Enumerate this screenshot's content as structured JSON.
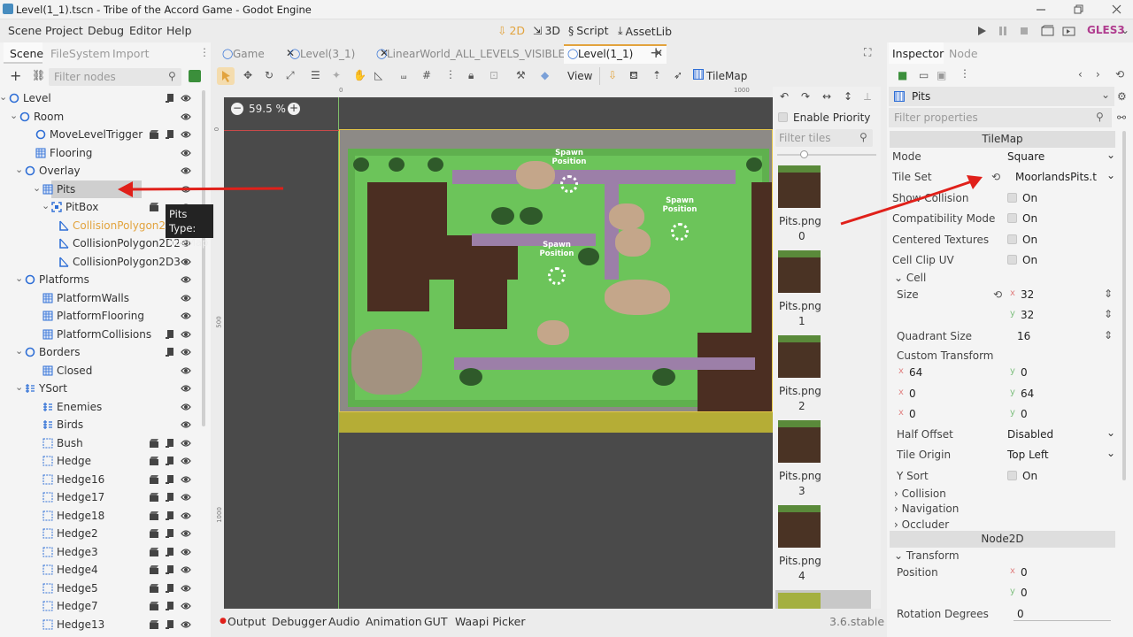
{
  "window": {
    "title": "Level(1_1).tscn - Tribe of the Accord Game - Godot Engine"
  },
  "menu": {
    "items": [
      "Scene",
      "Project",
      "Debug",
      "Editor",
      "Help"
    ]
  },
  "workspaces": {
    "w2d": "2D",
    "w3d": "3D",
    "script": "Script",
    "assetlib": "AssetLib"
  },
  "renderer": "GLES3",
  "scene_dock": {
    "tabs": [
      "Scene",
      "FileSystem",
      "Import"
    ],
    "filter_placeholder": "Filter nodes",
    "tree": [
      {
        "label": "Level"
      },
      {
        "label": "Room"
      },
      {
        "label": "MoveLevelTrigger"
      },
      {
        "label": "Flooring"
      },
      {
        "label": "Overlay"
      },
      {
        "label": "Pits"
      },
      {
        "label": "PitBox"
      },
      {
        "label": "CollisionPolygon2D"
      },
      {
        "label": "CollisionPolygon2D2"
      },
      {
        "label": "CollisionPolygon2D3"
      },
      {
        "label": "Platforms"
      },
      {
        "label": "PlatformWalls"
      },
      {
        "label": "PlatformFlooring"
      },
      {
        "label": "PlatformCollisions"
      },
      {
        "label": "Borders"
      },
      {
        "label": "Closed"
      },
      {
        "label": "YSort"
      },
      {
        "label": "Enemies"
      },
      {
        "label": "Birds"
      },
      {
        "label": "Bush"
      },
      {
        "label": "Hedge"
      },
      {
        "label": "Hedge16"
      },
      {
        "label": "Hedge17"
      },
      {
        "label": "Hedge18"
      },
      {
        "label": "Hedge2"
      },
      {
        "label": "Hedge3"
      },
      {
        "label": "Hedge4"
      },
      {
        "label": "Hedge5"
      },
      {
        "label": "Hedge7"
      },
      {
        "label": "Hedge13"
      }
    ],
    "tooltip": {
      "name": "Pits",
      "type": "Type: TileMap"
    }
  },
  "editor_tabs": [
    "Game",
    "Level(3_1)",
    "LinearWorld_ALL_LEVELS_VISIBLE",
    "Level(1_1)"
  ],
  "toolbar": {
    "view": "View",
    "tilemap": "TileMap"
  },
  "viewport": {
    "zoom": "59.5 %",
    "ruler_ticks": [
      "0",
      "1000"
    ],
    "vruler_ticks": [
      "0",
      "500",
      "1000"
    ],
    "spawn_label_line1": "Spawn",
    "spawn_label_line2": "Position"
  },
  "tile_palette": {
    "enable_priority": "Enable Priority",
    "filter_placeholder": "Filter tiles",
    "tiles": [
      {
        "name": "Pits.png",
        "index": "0"
      },
      {
        "name": "Pits.png",
        "index": "1"
      },
      {
        "name": "Pits.png",
        "index": "2"
      },
      {
        "name": "Pits.png",
        "index": "3"
      },
      {
        "name": "Pits.png",
        "index": "4"
      }
    ]
  },
  "inspector": {
    "tabs": [
      "Inspector",
      "Node"
    ],
    "node_name": "Pits",
    "filter_placeholder": "Filter properties",
    "class_header": "TileMap",
    "mode": {
      "label": "Mode",
      "value": "Square"
    },
    "tile_set": {
      "label": "Tile Set",
      "value": "MoorlandsPits.t"
    },
    "show_collision": {
      "label": "Show Collision",
      "value": "On"
    },
    "compat_mode": {
      "label": "Compatibility Mode",
      "value": "On"
    },
    "centered": {
      "label": "Centered Textures",
      "value": "On"
    },
    "cell_clip": {
      "label": "Cell Clip UV",
      "value": "On"
    },
    "cell_section": "Cell",
    "size": {
      "label": "Size",
      "x": "32",
      "y": "32"
    },
    "quadrant": {
      "label": "Quadrant Size",
      "value": "16"
    },
    "custom_transform": {
      "label": "Custom Transform",
      "rows": [
        [
          "64",
          "0"
        ],
        [
          "0",
          "64"
        ],
        [
          "0",
          "0"
        ]
      ]
    },
    "half_offset": {
      "label": "Half Offset",
      "value": "Disabled"
    },
    "tile_origin": {
      "label": "Tile Origin",
      "value": "Top Left"
    },
    "ysort": {
      "label": "Y Sort",
      "value": "On"
    },
    "collision": "Collision",
    "navigation": "Navigation",
    "occluder": "Occluder",
    "node2d_header": "Node2D",
    "transform_section": "Transform",
    "position": {
      "label": "Position",
      "x": "0",
      "y": "0"
    },
    "rotation": {
      "label": "Rotation Degrees",
      "value": "0"
    }
  },
  "bottom": {
    "tabs": [
      "Output",
      "Debugger",
      "Audio",
      "Animation",
      "GUT",
      "Waapi Picker"
    ],
    "version": "3.6.stable"
  },
  "axis_letters": {
    "x": "x",
    "y": "y"
  },
  "colors": {
    "accent": "#e2a33d",
    "node_blue": "#2f6fd6",
    "selected": "#cfcfcf",
    "annotation": "#e0201a",
    "viewport_bg": "#4a4a4a"
  }
}
